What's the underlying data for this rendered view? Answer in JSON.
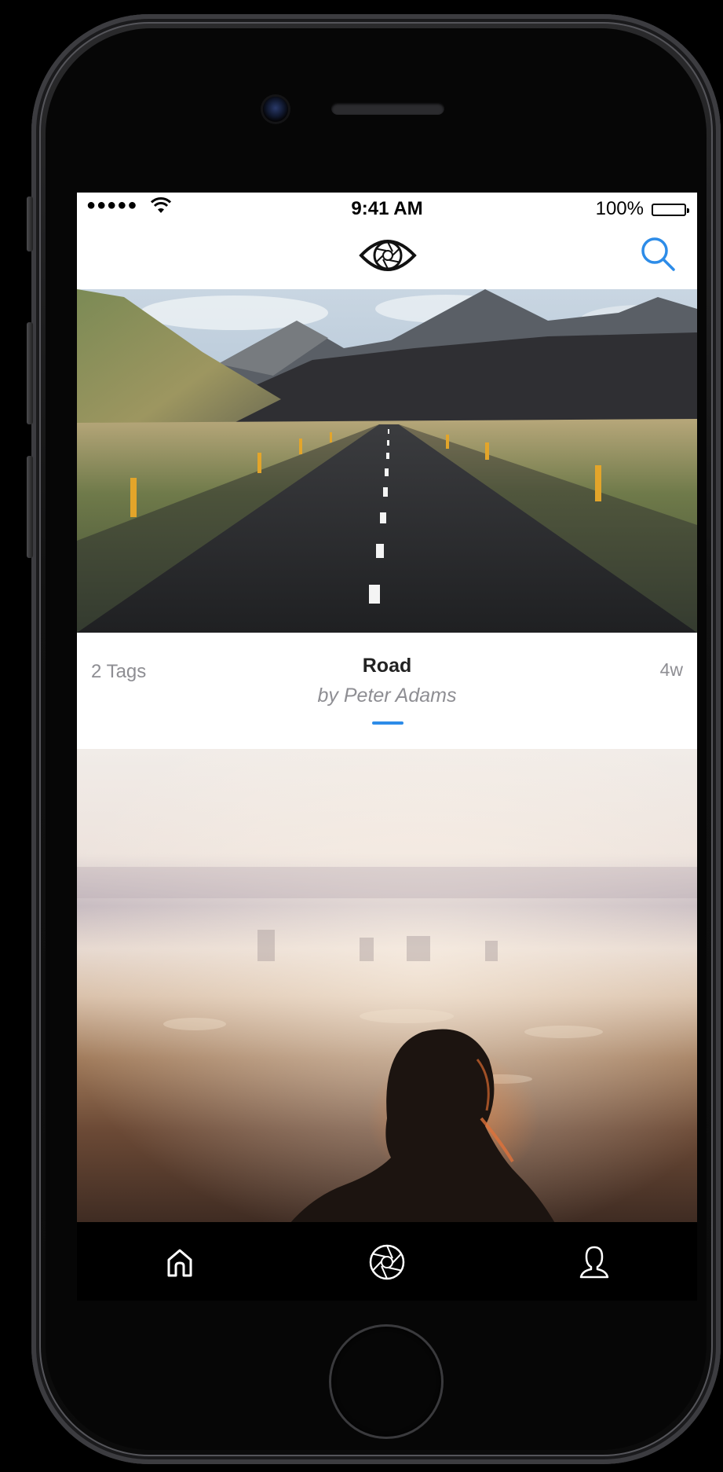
{
  "status_bar": {
    "signal": "●●●●●",
    "time": "9:41 AM",
    "battery_percent": "100%",
    "battery_level": 1.0
  },
  "nav_bar": {
    "logo_icon": "aperture-eye-logo-icon",
    "search_icon": "search-icon",
    "accent_color": "#2d8ce8"
  },
  "feed": {
    "items": [
      {
        "image": "road-landscape-photo",
        "tags": "2 Tags",
        "title": "Road",
        "author": "by Peter Adams",
        "age": "4w"
      },
      {
        "image": "woman-silhouette-sunset-photo"
      }
    ]
  },
  "tab_bar": {
    "items": [
      {
        "icon": "home-icon",
        "selected": true
      },
      {
        "icon": "aperture-icon",
        "selected": false
      },
      {
        "icon": "profile-icon",
        "selected": false
      }
    ]
  }
}
